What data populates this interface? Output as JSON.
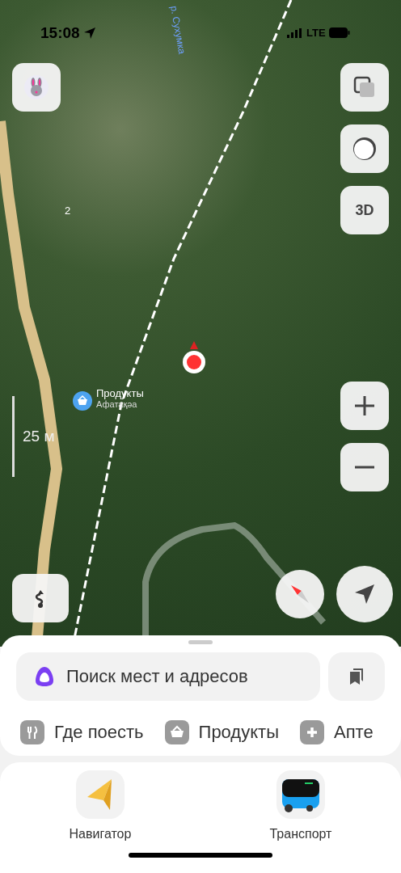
{
  "status_bar": {
    "time": "15:08",
    "network": "LTE"
  },
  "map": {
    "street_label": "р. Сухумка",
    "building_number": "2",
    "poi": {
      "name": "Продукты",
      "subtitle": "Афатақәа"
    },
    "scale": "25 м"
  },
  "map_controls": {
    "layers_button": {
      "kind": "layers"
    },
    "style_button": {
      "kind": "style"
    },
    "three_d_button": "3D"
  },
  "search": {
    "placeholder": "Поиск мест и адресов"
  },
  "categories": [
    {
      "kind": "food",
      "label": "Где поесть"
    },
    {
      "kind": "grocery",
      "label": "Продукты"
    },
    {
      "kind": "pharmacy",
      "label": "Апте"
    }
  ],
  "apps": [
    {
      "kind": "navigator",
      "label": "Навигатор"
    },
    {
      "kind": "transport",
      "label": "Транспорт"
    }
  ]
}
